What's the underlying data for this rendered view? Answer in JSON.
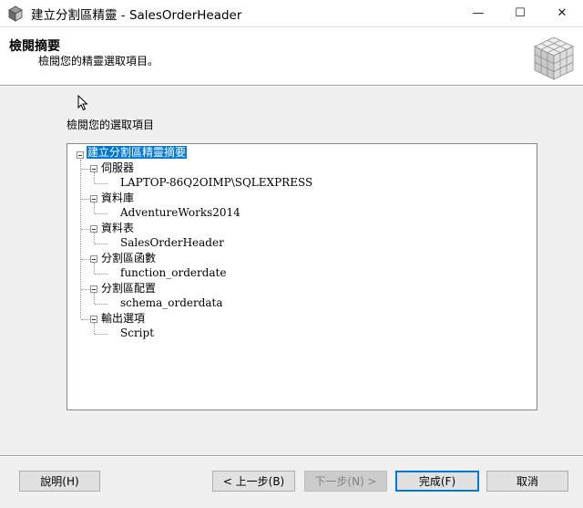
{
  "window": {
    "title": "建立分割區精靈 - SalesOrderHeader",
    "minimize_glyph": "—",
    "maximize_glyph": "☐",
    "close_glyph": "✕"
  },
  "header": {
    "title": "檢閱摘要",
    "subtitle": "檢閱您的精靈選取項目。",
    "graphic_icon": "cube-grid-icon"
  },
  "section_label": "檢閱您的選取項目",
  "tree": {
    "root": "建立分割區精靈摘要",
    "groups": [
      {
        "label": "伺服器",
        "value": "LAPTOP-86Q2OIMP\\SQLEXPRESS"
      },
      {
        "label": "資料庫",
        "value": "AdventureWorks2014"
      },
      {
        "label": "資料表",
        "value": "SalesOrderHeader"
      },
      {
        "label": "分割區函數",
        "value": "function_orderdate"
      },
      {
        "label": "分割區配置",
        "value": "schema_orderdata"
      },
      {
        "label": "輸出選項",
        "value": "Script"
      }
    ]
  },
  "buttons": {
    "help": "說明(H)",
    "back": "< 上一步(B)",
    "next": "下一步(N) >",
    "finish": "完成(F)",
    "cancel": "取消"
  },
  "colors": {
    "selection": "#0078d7",
    "primary_border": "#0078d7"
  }
}
